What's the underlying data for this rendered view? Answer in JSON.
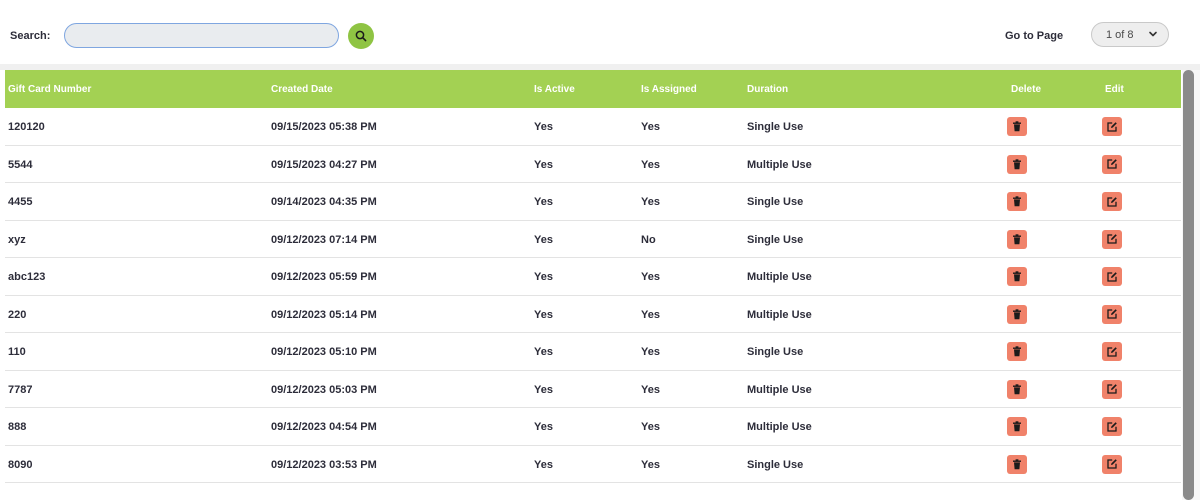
{
  "toolbar": {
    "search_label": "Search:",
    "search_value": "",
    "search_placeholder": "",
    "goto_label": "Go to Page",
    "page_select_value": "1 of 8"
  },
  "table": {
    "headers": {
      "number": "Gift Card Number",
      "created": "Created Date",
      "active": "Is Active",
      "assigned": "Is Assigned",
      "duration": "Duration",
      "delete": "Delete",
      "edit": "Edit"
    },
    "rows": [
      {
        "number": "120120",
        "created": "09/15/2023 05:38 PM",
        "active": "Yes",
        "assigned": "Yes",
        "duration": "Single Use"
      },
      {
        "number": "5544",
        "created": "09/15/2023 04:27 PM",
        "active": "Yes",
        "assigned": "Yes",
        "duration": "Multiple Use"
      },
      {
        "number": "4455",
        "created": "09/14/2023 04:35 PM",
        "active": "Yes",
        "assigned": "Yes",
        "duration": "Single Use"
      },
      {
        "number": "xyz",
        "created": "09/12/2023 07:14 PM",
        "active": "Yes",
        "assigned": "No",
        "duration": "Single Use"
      },
      {
        "number": "abc123",
        "created": "09/12/2023 05:59 PM",
        "active": "Yes",
        "assigned": "Yes",
        "duration": "Multiple Use"
      },
      {
        "number": "220",
        "created": "09/12/2023 05:14 PM",
        "active": "Yes",
        "assigned": "Yes",
        "duration": "Multiple Use"
      },
      {
        "number": "110",
        "created": "09/12/2023 05:10 PM",
        "active": "Yes",
        "assigned": "Yes",
        "duration": "Single Use"
      },
      {
        "number": "7787",
        "created": "09/12/2023 05:03 PM",
        "active": "Yes",
        "assigned": "Yes",
        "duration": "Multiple Use"
      },
      {
        "number": "888",
        "created": "09/12/2023 04:54 PM",
        "active": "Yes",
        "assigned": "Yes",
        "duration": "Multiple Use"
      },
      {
        "number": "8090",
        "created": "09/12/2023 03:53 PM",
        "active": "Yes",
        "assigned": "Yes",
        "duration": "Single Use"
      }
    ]
  },
  "icons": {
    "search": "search-icon",
    "dropdown": "chevron-down-icon",
    "delete": "trash-icon",
    "edit": "edit-icon"
  },
  "colors": {
    "accent_green": "#a3d153",
    "search_button": "#8fc443",
    "action_button": "#f0826a"
  }
}
